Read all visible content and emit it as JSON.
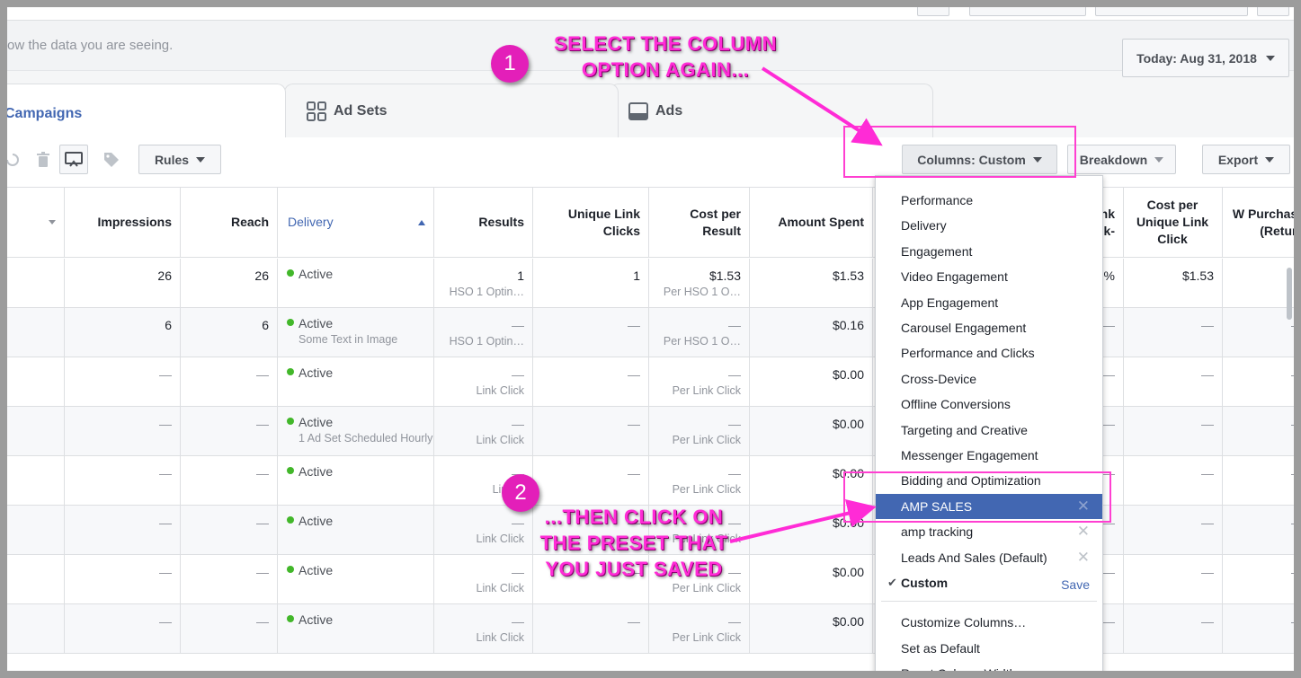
{
  "subheader": {
    "hint": "ow the data you are seeing.",
    "date_label": "Today: Aug 31, 2018"
  },
  "tabs": [
    {
      "label": "Campaigns",
      "icon": "campaign-icon"
    },
    {
      "label": "Ad Sets",
      "icon": "grid-icon"
    },
    {
      "label": "Ads",
      "icon": "ad-icon"
    }
  ],
  "toolbar": {
    "rules": "Rules",
    "columns_prefix": "Columns: ",
    "columns_value": "Custom",
    "breakdown": "Breakdown",
    "export": "Export"
  },
  "table": {
    "headers": {
      "impressions": "Impressions",
      "reach": "Reach",
      "delivery": "Delivery",
      "results": "Results",
      "unique_link_clicks": "Unique Link Clicks",
      "cost_per_result": "Cost per Result",
      "amount_spent": "Amount Spent",
      "ctr_partial": "ue nk k-",
      "cost_unique_link_click": "Cost per Unique Link Click",
      "purchases_partial": "W Purchase (Return"
    },
    "rows": [
      {
        "impressions": "26",
        "reach": "26",
        "delivery": "Active",
        "delivery_sub": "",
        "results": "1",
        "results_sub": "HSO 1 Optin…",
        "ulc": "1",
        "cpr": "$1.53",
        "cpr_sub": "Per HSO 1 O…",
        "spent": "$1.53",
        "ctr": "%",
        "cpulc": "$1.53",
        "purch": ""
      },
      {
        "impressions": "6",
        "reach": "6",
        "delivery": "Active",
        "delivery_sub": "Some Text in Image",
        "results": "—",
        "results_sub": "HSO 1 Optin…",
        "ulc": "—",
        "cpr": "—",
        "cpr_sub": "Per HSO 1 O…",
        "spent": "$0.16",
        "ctr": "—",
        "cpulc": "—",
        "purch": "—"
      },
      {
        "impressions": "—",
        "reach": "—",
        "delivery": "Active",
        "delivery_sub": "",
        "results": "—",
        "results_sub": "Link Click",
        "ulc": "—",
        "cpr": "—",
        "cpr_sub": "Per Link Click",
        "spent": "$0.00",
        "ctr": "—",
        "cpulc": "—",
        "purch": "—"
      },
      {
        "impressions": "—",
        "reach": "—",
        "delivery": "Active",
        "delivery_sub": "1 Ad Set Scheduled Hourly",
        "results": "—",
        "results_sub": "Link Click",
        "ulc": "—",
        "cpr": "—",
        "cpr_sub": "Per Link Click",
        "spent": "$0.00",
        "ctr": "—",
        "cpulc": "—",
        "purch": "—"
      },
      {
        "impressions": "—",
        "reach": "—",
        "delivery": "Active",
        "delivery_sub": "",
        "results": "—",
        "results_sub": "Link C",
        "ulc": "—",
        "cpr": "—",
        "cpr_sub": "Per Link Click",
        "spent": "$0.00",
        "ctr": "—",
        "cpulc": "—",
        "purch": "—"
      },
      {
        "impressions": "—",
        "reach": "—",
        "delivery": "Active",
        "delivery_sub": "",
        "results": "—",
        "results_sub": "Link Click",
        "ulc": "—",
        "cpr": "—",
        "cpr_sub": "Per Link Click",
        "spent": "$0.00",
        "ctr": "—",
        "cpulc": "—",
        "purch": "—"
      },
      {
        "impressions": "—",
        "reach": "—",
        "delivery": "Active",
        "delivery_sub": "",
        "results": "—",
        "results_sub": "Link Click",
        "ulc": "—",
        "cpr": "—",
        "cpr_sub": "Per Link Click",
        "spent": "$0.00",
        "ctr": "—",
        "cpulc": "—",
        "purch": "—"
      },
      {
        "impressions": "—",
        "reach": "—",
        "delivery": "Active",
        "delivery_sub": "",
        "results": "—",
        "results_sub": "Link Click",
        "ulc": "—",
        "cpr": "—",
        "cpr_sub": "Per Link Click",
        "spent": "$0.00",
        "ctr": "—",
        "cpulc": "—",
        "purch": "—"
      }
    ]
  },
  "columns_menu": {
    "presets": [
      "Performance",
      "Delivery",
      "Engagement",
      "Video Engagement",
      "App Engagement",
      "Carousel Engagement",
      "Performance and Clicks",
      "Cross-Device",
      "Offline Conversions",
      "Targeting and Creative",
      "Messenger Engagement",
      "Bidding and Optimization"
    ],
    "saved": [
      "AMP SALES",
      "amp tracking",
      "Leads And Sales (Default)"
    ],
    "current": "Custom",
    "save_label": "Save",
    "actions": [
      "Customize Columns…",
      "Set as Default",
      "Reset Column Widths"
    ]
  },
  "annotations": {
    "step1_number": "1",
    "step1_text": "SELECT THE COLUMN OPTION AGAIN...",
    "step2_number": "2",
    "step2_text": "...THEN CLICK ON THE PRESET THAT YOU JUST SAVED"
  },
  "colors": {
    "accent": "#4267b2",
    "annotation": "#ff2bd6",
    "active_dot": "#42b72a"
  }
}
